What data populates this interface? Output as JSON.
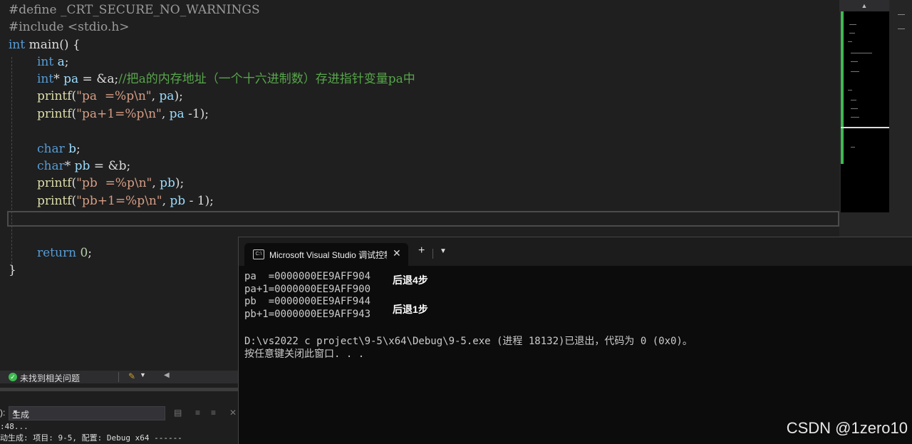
{
  "editor": {
    "lines": {
      "l1": {
        "pre": "#define",
        "rest": " _CRT_SECURE_NO_WARNINGS"
      },
      "l2": {
        "pre": "#include",
        "rest": " <stdio.h>"
      },
      "l3": {
        "kw": "int",
        "rest": " main() {"
      },
      "l4": {
        "kw": "int",
        "var": " a",
        "rest": ";"
      },
      "l5": {
        "kw": "int",
        "rest1": "* ",
        "var": "pa",
        "rest2": " = &a;",
        "comment": "//把a的内存地址（一个十六进制数）存进指针变量pa中"
      },
      "l6": {
        "fn": "printf",
        "p1": "(",
        "str": "\"pa  =%p\\n\"",
        "p2": ", ",
        "var": "pa",
        "p3": ");"
      },
      "l7": {
        "fn": "printf",
        "p1": "(",
        "str": "\"pa+1=%p\\n\"",
        "p2": ", ",
        "var": "pa",
        "p3": " -1);"
      },
      "l8": {
        "kw": "char",
        "var": " b",
        "rest": ";"
      },
      "l9": {
        "kw": "char",
        "rest1": "* ",
        "var": "pb",
        "rest2": " = &b;"
      },
      "l10": {
        "fn": "printf",
        "p1": "(",
        "str": "\"pb  =%p\\n\"",
        "p2": ", ",
        "var": "pb",
        "p3": ");"
      },
      "l11": {
        "fn": "printf",
        "p1": "(",
        "str": "\"pb+1=%p\\n\"",
        "p2": ", ",
        "var": "pb",
        "p3": " - 1);"
      },
      "l12": {
        "kw": "return",
        "num": " 0",
        "rest": ";"
      },
      "l13": {
        "rest": "}"
      }
    }
  },
  "status_bar": {
    "message": "未找到相关问题"
  },
  "output": {
    "label": "):",
    "source": "生成",
    "line1": ":48...",
    "line2": "动生成: 项目: 9-5, 配置: Debug x64 ------"
  },
  "console": {
    "tab_title": "Microsoft Visual Studio 调试控制台",
    "tab_icon": "C:\\",
    "new_tab": "+",
    "lines": [
      "pa  =0000000EE9AFF904",
      "pa+1=0000000EE9AFF900",
      "pb  =0000000EE9AFF944",
      "pb+1=0000000EE9AFF943",
      "",
      "D:\\vs2022 c project\\9-5\\x64\\Debug\\9-5.exe (进程 18132)已退出，代码为 0 (0x0)。",
      "按任意键关闭此窗口. . ."
    ],
    "annotation1": "后退4步",
    "annotation2": "后退1步"
  },
  "watermark": "CSDN @1zero10",
  "icons": {
    "status_ok": "check-circle-icon",
    "broom": "broom-icon",
    "console_app": "terminal-icon",
    "close": "close-icon",
    "dropdown": "chevron-down-icon"
  },
  "colors": {
    "keyword": "#569cd6",
    "function": "#dcdcaa",
    "string": "#d69d85",
    "comment": "#57a64a",
    "variable": "#9cdcfe",
    "minimap_marker": "#3fb950"
  }
}
